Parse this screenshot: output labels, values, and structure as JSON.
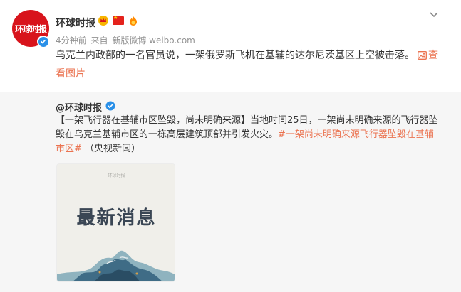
{
  "post": {
    "author": "环球时报",
    "avatar_text": "环球时报",
    "time": "4分钟前",
    "source_prefix": "来自",
    "source": "新版微博 weibo.com",
    "text": "乌克兰内政部的一名官员说，一架俄罗斯飞机在基辅的达尔尼茨基区上空被击落。",
    "see_images": "查看图片",
    "icons": [
      "verified-icon",
      "vip-crown-icon",
      "china-flag-icon",
      "fan-badge-icon",
      "chevron-down-icon",
      "image-icon"
    ]
  },
  "repost": {
    "author": "@环球时报",
    "text_intro": "【一架飞行器在基辅市区坠毁，尚未明确来源】当地时间25日，一架尚未明确来源的飞行器坠毁在乌克兰基辅市区的一栋高层建筑顶部并引发火灾。",
    "hashtag": "#一架尚未明确来源飞行器坠毁在基辅市区#",
    "text_tail": "（央视新闻）",
    "thumbnail": {
      "small_label": "环球时报",
      "title": "最新消息"
    }
  },
  "colors": {
    "link": "#eb7350",
    "brand": "#d8141c",
    "verify": "#2a90e8"
  }
}
